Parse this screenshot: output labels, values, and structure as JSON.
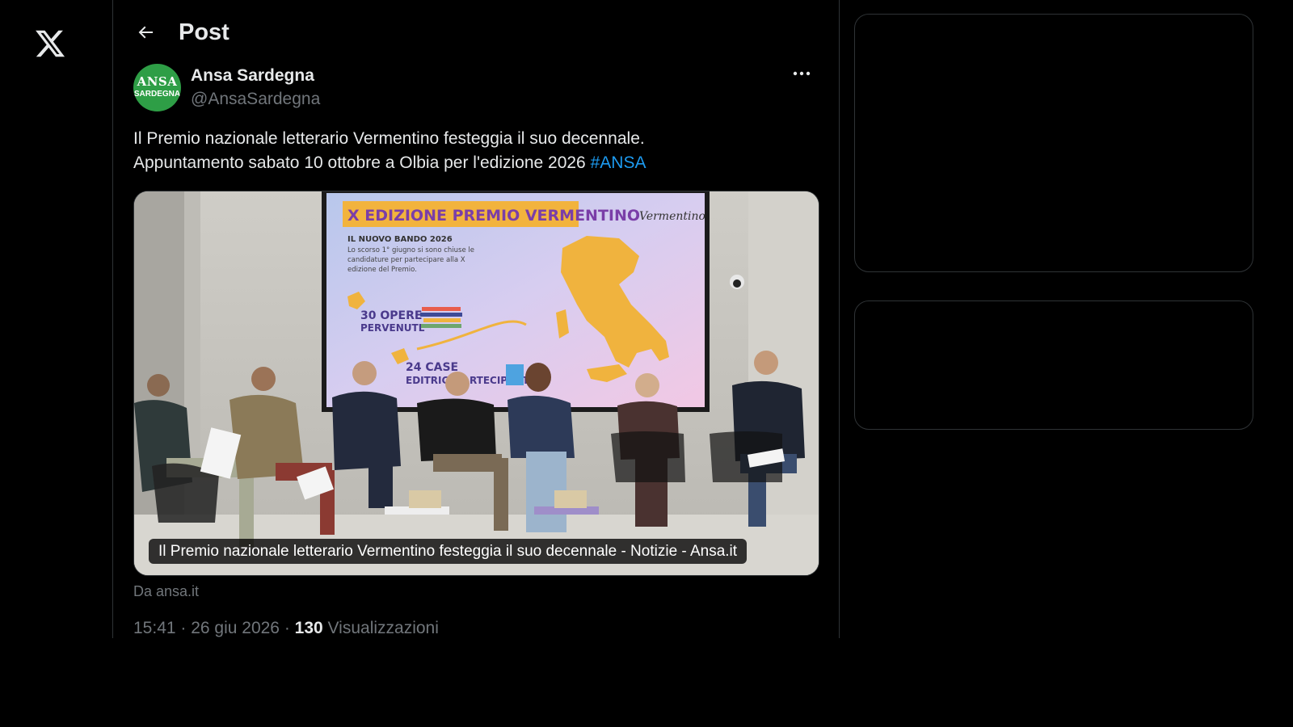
{
  "nav": {
    "logo_icon": "x-logo-icon"
  },
  "header": {
    "back_icon": "arrow-left-icon",
    "title": "Post"
  },
  "post": {
    "author": {
      "avatar_text_top": "ANSA",
      "avatar_text_bottom": "SARDEGNA",
      "avatar_color": "#2e9e46",
      "display_name": "Ansa Sardegna",
      "handle": "@AnsaSardegna"
    },
    "more_icon": "more-horizontal-icon",
    "text_line1": "Il Premio nazionale letterario Vermentino festeggia il suo decennale.",
    "text_line2": "Appuntamento sabato 10 ottobre a Olbia per l'edizione 2026",
    "hashtag": "#ANSA",
    "media": {
      "caption": "Il Premio nazionale letterario Vermentino festeggia il suo decennale - Notizie - Ansa.it",
      "screen_title": "X EDIZIONE PREMIO VERMENTINO",
      "screen_bando": "IL NUOVO BANDO 2026",
      "screen_bando_text1": "Lo scorso 1° giugno si sono chiuse le",
      "screen_bando_text2": "candidature per partecipare alla X",
      "screen_bando_text3": "edizione del Premio.",
      "screen_opere_num": "30 OPERE",
      "screen_opere_label": "PERVENUTE",
      "screen_case_num": "24 CASE",
      "screen_case_label": "EDITRICI PARTECIPANTI",
      "screen_logo": "Vermentino"
    },
    "source": "Da ansa.it",
    "timestamp": "15:41 · 26 giu 2026 · ",
    "views_count": "130",
    "views_label": " Visualizzazioni"
  },
  "colors": {
    "link": "#1d9bf0",
    "muted": "#71767b",
    "text": "#e7e9ea",
    "border": "#2f3336"
  }
}
